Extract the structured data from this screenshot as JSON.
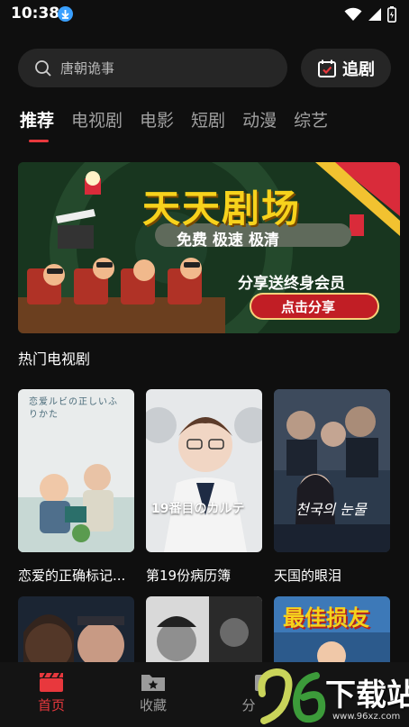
{
  "status": {
    "time": "10:38"
  },
  "search": {
    "placeholder": "唐朝诡事"
  },
  "follow": {
    "label": "追剧"
  },
  "tabs": [
    "推荐",
    "电视剧",
    "电影",
    "短剧",
    "动漫",
    "综艺"
  ],
  "banner": {
    "title": "天天剧场",
    "subtitle": "免费 极速 极清",
    "promo": "分享送终身会员",
    "cta": "点击分享"
  },
  "section": {
    "title": "热门电视剧"
  },
  "cards": [
    {
      "title": "恋爱的正确标记...",
      "poster_text": "恋爱ルビの正しいふりかた"
    },
    {
      "title": "第19份病历簿",
      "poster_text": "19番目のカルテ"
    },
    {
      "title": "天国的眼泪",
      "poster_text": "천국의 눈물"
    }
  ],
  "row2": {
    "poster3_text": "最佳损友"
  },
  "nav": [
    {
      "label": "首页",
      "icon": "clapperboard-icon"
    },
    {
      "label": "收藏",
      "icon": "folder-star-icon"
    },
    {
      "label": "分"
    }
  ],
  "watermark": {
    "site": "下载站",
    "url": "www.96xz.com",
    "logo": "96"
  },
  "colors": {
    "accent": "#e8383d",
    "background": "#0f0f0f",
    "surface": "#262626"
  }
}
